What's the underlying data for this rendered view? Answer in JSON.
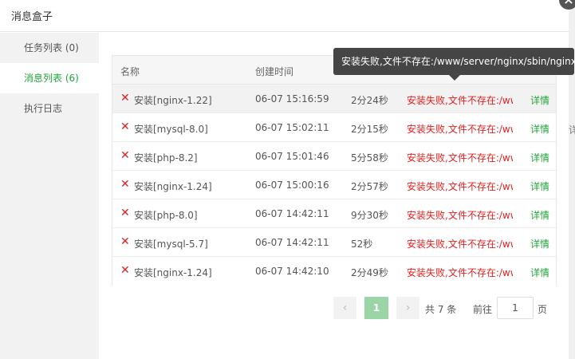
{
  "dialog": {
    "title": "消息盒子",
    "close_icon": "×"
  },
  "sidebar": {
    "items": [
      {
        "label": "任务列表 (0)"
      },
      {
        "label": "消息列表 (6)"
      },
      {
        "label": "执行日志"
      }
    ]
  },
  "table": {
    "headers": [
      "名称",
      "创建时间",
      "",
      "",
      ""
    ],
    "rows": [
      {
        "name": "安装[nginx-1.22]",
        "time": "06-07 15:16:59",
        "duration": "2分24秒",
        "message": "安装失败,文件不存在:/www/server/nginx/sbin/nginx",
        "detail": "详情"
      },
      {
        "name": "安装[mysql-8.0]",
        "time": "06-07 15:02:11",
        "duration": "2分15秒",
        "message": "安装失败,文件不存在:/www/server/nginx/sbin/nginx",
        "detail": "详情"
      },
      {
        "name": "安装[php-8.2]",
        "time": "06-07 15:01:46",
        "duration": "5分58秒",
        "message": "安装失败,文件不存在:/www/server/nginx/sbin/nginx",
        "detail": "详情"
      },
      {
        "name": "安装[nginx-1.24]",
        "time": "06-07 15:00:16",
        "duration": "2分57秒",
        "message": "安装失败,文件不存在:/www/server/nginx/sbin/nginx",
        "detail": "详情"
      },
      {
        "name": "安装[php-8.0]",
        "time": "06-07 14:42:11",
        "duration": "9分30秒",
        "message": "安装失败,文件不存在:/www/server/nginx/sbin/nginx",
        "detail": "详情"
      },
      {
        "name": "安装[mysql-5.7]",
        "time": "06-07 14:42:11",
        "duration": "52秒",
        "message": "安装失败,文件不存在:/www/server/nginx/sbin/nginx",
        "detail": "详情"
      },
      {
        "name": "安装[nginx-1.24]",
        "time": "06-07 14:42:10",
        "duration": "2分49秒",
        "message": "安装失败,文件不存在:/www/server/nginx/sbin/nginx",
        "detail": "详情"
      }
    ],
    "status_icon": "✕"
  },
  "tooltip": {
    "text": "安装失败,文件不存在:/www/server/nginx/sbin/nginx"
  },
  "pagination": {
    "prev": "‹",
    "current": "1",
    "next": "›",
    "total": "共 7 条",
    "goto_label": "前往",
    "goto_value": "1",
    "page_suffix": "页"
  },
  "background_fragment": "详",
  "colors": {
    "accent": "#20a53a",
    "error": "#e02020"
  }
}
